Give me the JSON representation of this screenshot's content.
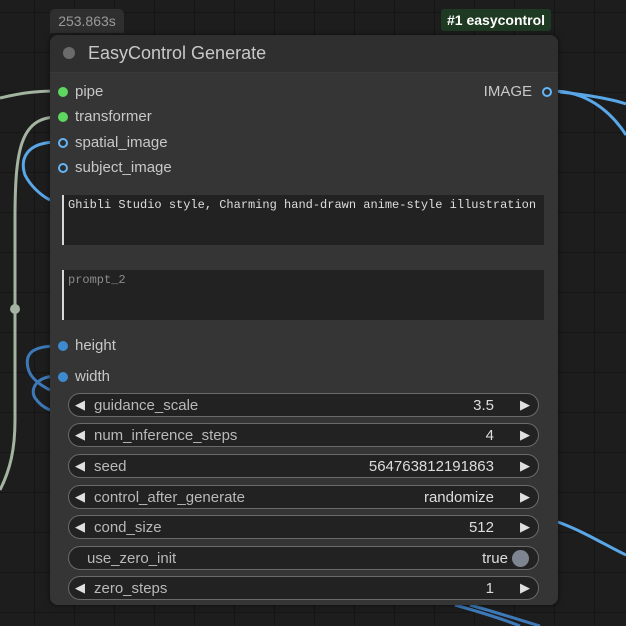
{
  "exec_time": "253.863s",
  "node_badge": "#1 easycontrol",
  "node": {
    "title": "EasyControl Generate",
    "inputs": [
      {
        "label": "pipe",
        "type": "connected"
      },
      {
        "label": "transformer",
        "type": "connected"
      },
      {
        "label": "spatial_image",
        "type": "optional"
      },
      {
        "label": "subject_image",
        "type": "optional"
      }
    ],
    "output": {
      "label": "IMAGE"
    },
    "prompt": {
      "value": "Ghibli Studio style, Charming hand-drawn anime-style illustration"
    },
    "prompt_2": {
      "placeholder": "prompt_2"
    },
    "converted_inputs": [
      {
        "label": "height"
      },
      {
        "label": "width"
      }
    ],
    "widgets": [
      {
        "name": "guidance_scale",
        "value": "3.5"
      },
      {
        "name": "num_inference_steps",
        "value": "4"
      },
      {
        "name": "seed",
        "value": "564763812191863"
      },
      {
        "name": "control_after_generate",
        "value": "randomize"
      },
      {
        "name": "cond_size",
        "value": "512"
      }
    ],
    "toggle": {
      "name": "use_zero_init",
      "value": "true"
    },
    "last_widget": {
      "name": "zero_steps",
      "value": "1"
    }
  },
  "colors": {
    "canvas": "#1d1d1d",
    "node_body": "#353535",
    "node_header": "#2f2f2f",
    "wire_green": "#a3b4a0",
    "wire_blue": "#5aa7e8",
    "slot_green": "#5fd660",
    "slot_blue": "#64b5f6"
  }
}
